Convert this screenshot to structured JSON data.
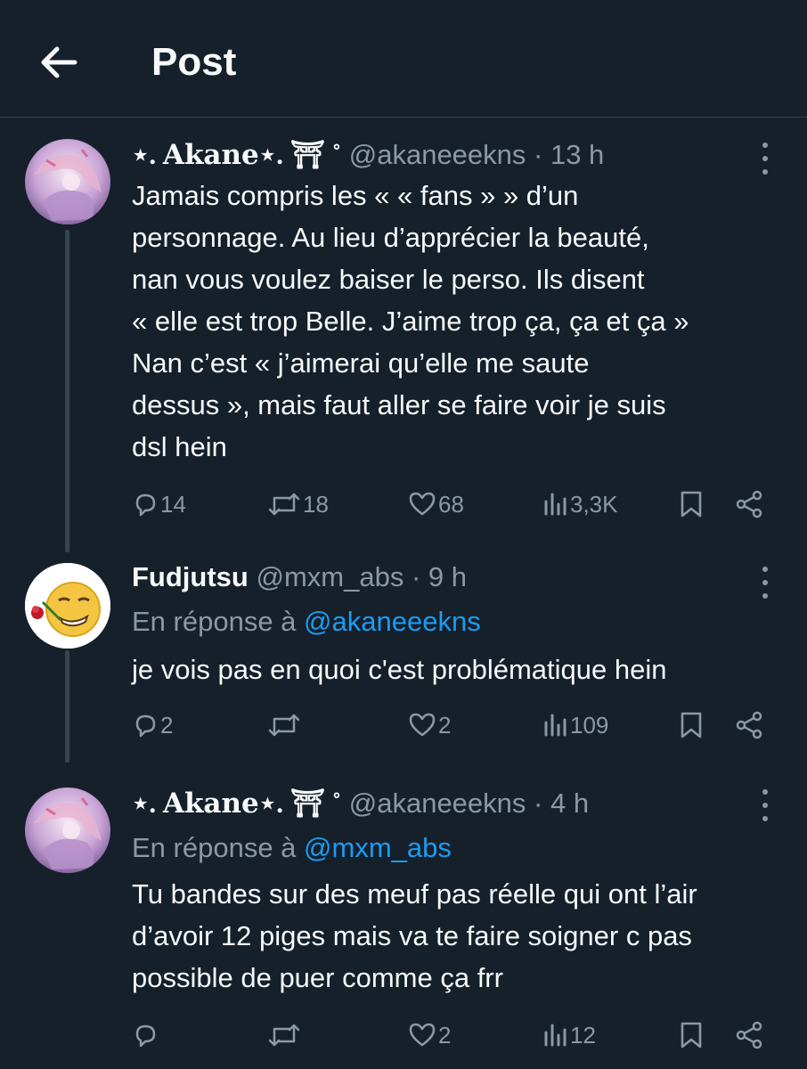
{
  "header": {
    "title": "Post",
    "back_icon": "arrow-left-icon"
  },
  "tweets": [
    {
      "name": "⋆. 𝐀𝐤𝐚𝐧𝐞⋆. ⛩ ˚",
      "handle": "@akaneeekns",
      "time": "· 13 h",
      "reply_to_label": "",
      "reply_to_handle": "",
      "text": "Jamais compris les « « fans » » d’un\npersonnage. Au lieu d’apprécier la beauté,\nnan vous voulez baiser le perso. Ils disent\n« elle est trop Belle. J’aime trop ça, ça et ça »\nNan c’est « j’aimerai qu’elle me saute\ndessus », mais faut aller se faire voir je suis\ndsl hein",
      "replies": "14",
      "reposts": "18",
      "likes": "68",
      "views": "3,3K"
    },
    {
      "name": "Fudjutsu",
      "handle": "@mxm_abs",
      "time": "· 9 h",
      "reply_to_label": "En réponse à",
      "reply_to_handle": "@akaneeekns",
      "text": "je vois pas en quoi c'est problématique hein",
      "replies": "2",
      "reposts": "",
      "likes": "2",
      "views": "109"
    },
    {
      "name": "⋆. 𝐀𝐤𝐚𝐧𝐞⋆. ⛩ ˚",
      "handle": "@akaneeekns",
      "time": "· 4 h",
      "reply_to_label": "En réponse à",
      "reply_to_handle": "@mxm_abs",
      "text": "Tu bandes sur des meuf pas réelle qui ont l’air\nd’avoir 12 piges mais va te faire soigner c pas\npossible de puer comme ça frr",
      "replies": "",
      "reposts": "",
      "likes": "2",
      "views": "12"
    }
  ],
  "colors": {
    "background": "#15202b",
    "text": "#f7f9f9",
    "muted": "#8b98a5",
    "link": "#1d9bf0",
    "divider": "#38444d"
  }
}
